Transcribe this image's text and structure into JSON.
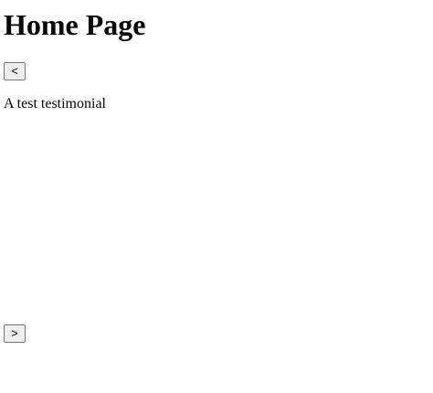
{
  "page": {
    "title": "Home Page"
  },
  "carousel": {
    "prev_label": "<",
    "next_label": ">",
    "testimonial_text": "A test testimonial"
  }
}
